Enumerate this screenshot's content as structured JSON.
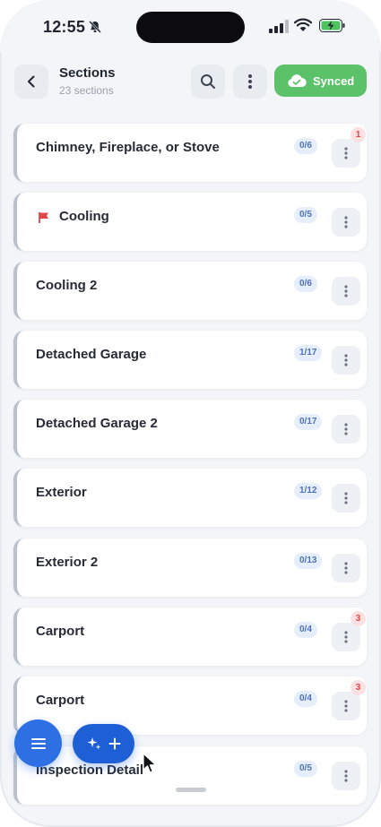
{
  "status_bar": {
    "time": "12:55"
  },
  "header": {
    "title": "Sections",
    "subtitle": "23 sections",
    "sync_label": "Synced"
  },
  "sections": [
    {
      "label": "Chimney, Fireplace, or Stove",
      "count": "0/6",
      "alerts": "1",
      "flagged": false
    },
    {
      "label": "Cooling",
      "count": "0/5",
      "alerts": "",
      "flagged": true
    },
    {
      "label": "Cooling 2",
      "count": "0/6",
      "alerts": "",
      "flagged": false
    },
    {
      "label": "Detached Garage",
      "count": "1/17",
      "alerts": "",
      "flagged": false
    },
    {
      "label": "Detached Garage 2",
      "count": "0/17",
      "alerts": "",
      "flagged": false
    },
    {
      "label": "Exterior",
      "count": "1/12",
      "alerts": "",
      "flagged": false
    },
    {
      "label": "Exterior 2",
      "count": "0/13",
      "alerts": "",
      "flagged": false
    },
    {
      "label": "Carport",
      "count": "0/4",
      "alerts": "3",
      "flagged": false
    },
    {
      "label": "Carport",
      "count": "0/4",
      "alerts": "3",
      "flagged": false
    },
    {
      "label": "Inspection Detail",
      "count": "0/5",
      "alerts": "",
      "flagged": false
    }
  ],
  "colors": {
    "accent": "#2f6fe4",
    "synced": "#5cc26a",
    "flag": "#e04646"
  },
  "icons": [
    "bell-slash-icon",
    "back-chevron-icon",
    "search-icon",
    "more-icon",
    "cloud-check-icon",
    "flag-icon",
    "kebab-icon",
    "menu-icon",
    "sparkle-icon",
    "plus-icon"
  ]
}
